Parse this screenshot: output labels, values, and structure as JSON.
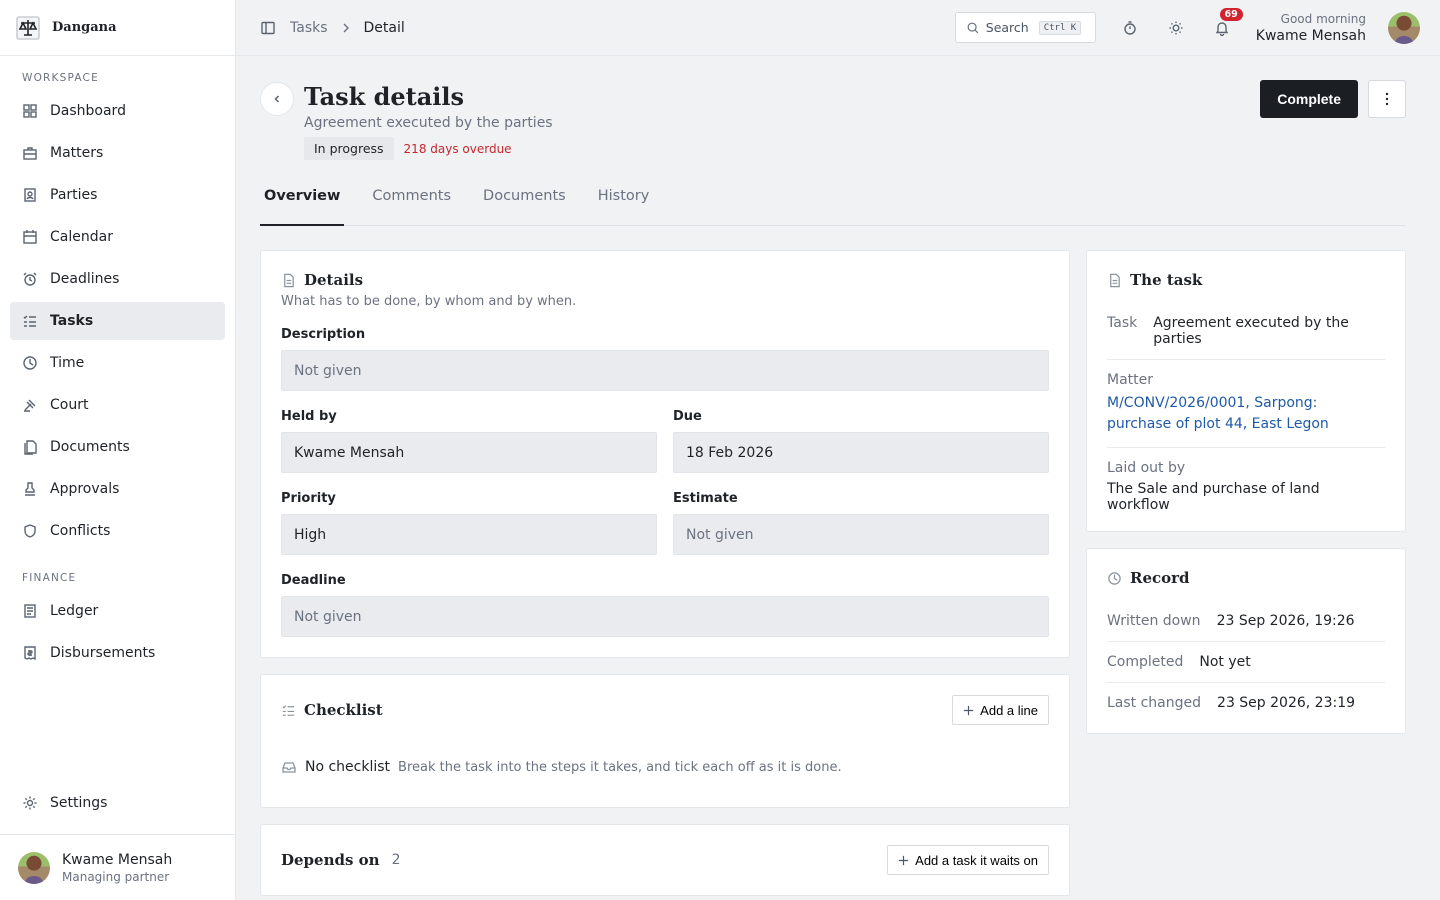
{
  "brand": {
    "name": "Dangana"
  },
  "sidebar": {
    "workspace_label": "WORKSPACE",
    "finance_label": "FINANCE",
    "workspace_items": [
      {
        "label": "Dashboard",
        "icon": "dashboard-icon"
      },
      {
        "label": "Matters",
        "icon": "briefcase-icon"
      },
      {
        "label": "Parties",
        "icon": "contact-icon"
      },
      {
        "label": "Calendar",
        "icon": "calendar-icon"
      },
      {
        "label": "Deadlines",
        "icon": "alarm-icon"
      },
      {
        "label": "Tasks",
        "icon": "tasks-icon"
      },
      {
        "label": "Time",
        "icon": "clock-icon"
      },
      {
        "label": "Court",
        "icon": "gavel-icon"
      },
      {
        "label": "Documents",
        "icon": "documents-icon"
      },
      {
        "label": "Approvals",
        "icon": "stamp-icon"
      },
      {
        "label": "Conflicts",
        "icon": "shield-icon"
      }
    ],
    "finance_items": [
      {
        "label": "Ledger",
        "icon": "ledger-icon"
      },
      {
        "label": "Disbursements",
        "icon": "receipt-icon"
      }
    ],
    "settings_label": "Settings",
    "user": {
      "name": "Kwame Mensah",
      "role": "Managing partner"
    }
  },
  "topbar": {
    "breadcrumb": [
      "Tasks",
      "Detail"
    ],
    "search_label": "Search",
    "search_shortcut": "Ctrl K",
    "notification_count": "69",
    "greeting": "Good morning",
    "user_name": "Kwame Mensah"
  },
  "page": {
    "title": "Task details",
    "subtitle": "Agreement executed by the parties",
    "status": "In progress",
    "overdue": "218 days overdue",
    "complete_label": "Complete"
  },
  "tabs": [
    "Overview",
    "Comments",
    "Documents",
    "History"
  ],
  "details": {
    "title": "Details",
    "subtitle": "What has to be done, by whom and by when.",
    "description_label": "Description",
    "description_value": "Not given",
    "held_by_label": "Held by",
    "held_by_value": "Kwame Mensah",
    "due_label": "Due",
    "due_value": "18 Feb 2026",
    "priority_label": "Priority",
    "priority_value": "High",
    "estimate_label": "Estimate",
    "estimate_value": "Not given",
    "deadline_label": "Deadline",
    "deadline_value": "Not given"
  },
  "checklist": {
    "title": "Checklist",
    "add_label": "Add a line",
    "empty_title": "No checklist",
    "empty_hint": "Break the task into the steps it takes, and tick each off as it is done."
  },
  "depends": {
    "title": "Depends on",
    "count": "2",
    "add_label": "Add a task it waits on"
  },
  "the_task": {
    "title": "The task",
    "task_label": "Task",
    "task_value": "Agreement executed by the parties",
    "matter_label": "Matter",
    "matter_value": "M/CONV/2026/0001, Sarpong: purchase of plot 44, East Legon",
    "laid_out_label": "Laid out by",
    "laid_out_value": "The Sale and purchase of land workflow"
  },
  "record": {
    "title": "Record",
    "written_label": "Written down",
    "written_value": "23 Sep 2026, 19:26",
    "completed_label": "Completed",
    "completed_value": "Not yet",
    "changed_label": "Last changed",
    "changed_value": "23 Sep 2026, 23:19"
  }
}
